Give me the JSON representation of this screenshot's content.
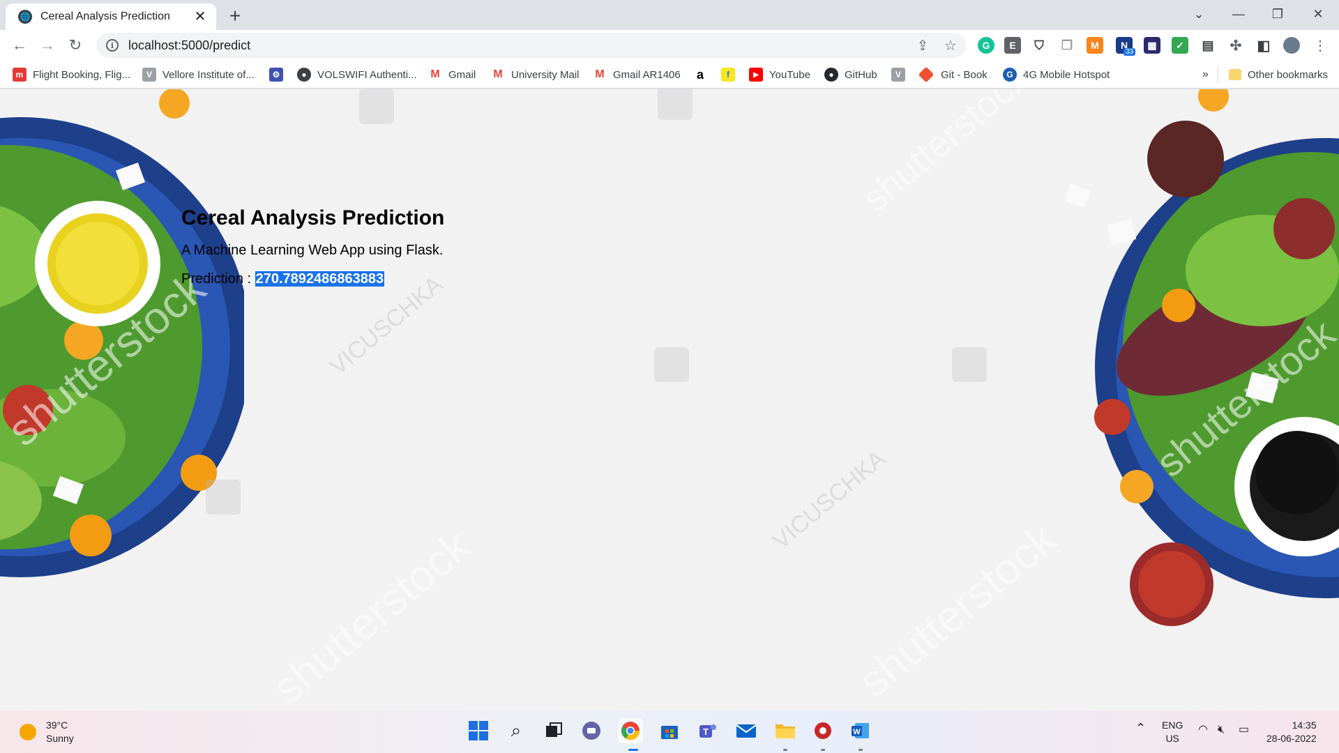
{
  "tab": {
    "title": "Cereal Analysis Prediction",
    "close": "✕",
    "new": "+"
  },
  "window": {
    "minimize": "—",
    "maximize": "❐",
    "close": "✕",
    "dropdown": "⌄"
  },
  "toolbar": {
    "url": "localhost:5000/predict",
    "info": "i"
  },
  "bookmarks": [
    {
      "label": "Flight Booking, Flig..."
    },
    {
      "label": "Vellore Institute of..."
    },
    {
      "label": ""
    },
    {
      "label": "VOLSWIFI Authenti..."
    },
    {
      "label": "Gmail"
    },
    {
      "label": "University Mail"
    },
    {
      "label": "Gmail AR1406"
    },
    {
      "label": ""
    },
    {
      "label": ""
    },
    {
      "label": "YouTube"
    },
    {
      "label": "GitHub"
    },
    {
      "label": ""
    },
    {
      "label": "Git - Book"
    },
    {
      "label": "4G Mobile Hotspot"
    }
  ],
  "bookmarks_more": "»",
  "other_bookmarks": "Other bookmarks",
  "page": {
    "title": "Cereal Analysis Prediction",
    "subtitle": "A Machine Learning Web App using Flask.",
    "prediction_label": "Prediction : ",
    "prediction_value": "270.7892486863883"
  },
  "watermarks": {
    "brand": "shutterstock",
    "author": "VICUSCHKA"
  },
  "ext_badge": "33",
  "taskbar": {
    "weather_temp": "39°C",
    "weather_desc": "Sunny",
    "lang": "ENG",
    "region": "US",
    "time": "14:35",
    "date": "28-06-2022"
  }
}
